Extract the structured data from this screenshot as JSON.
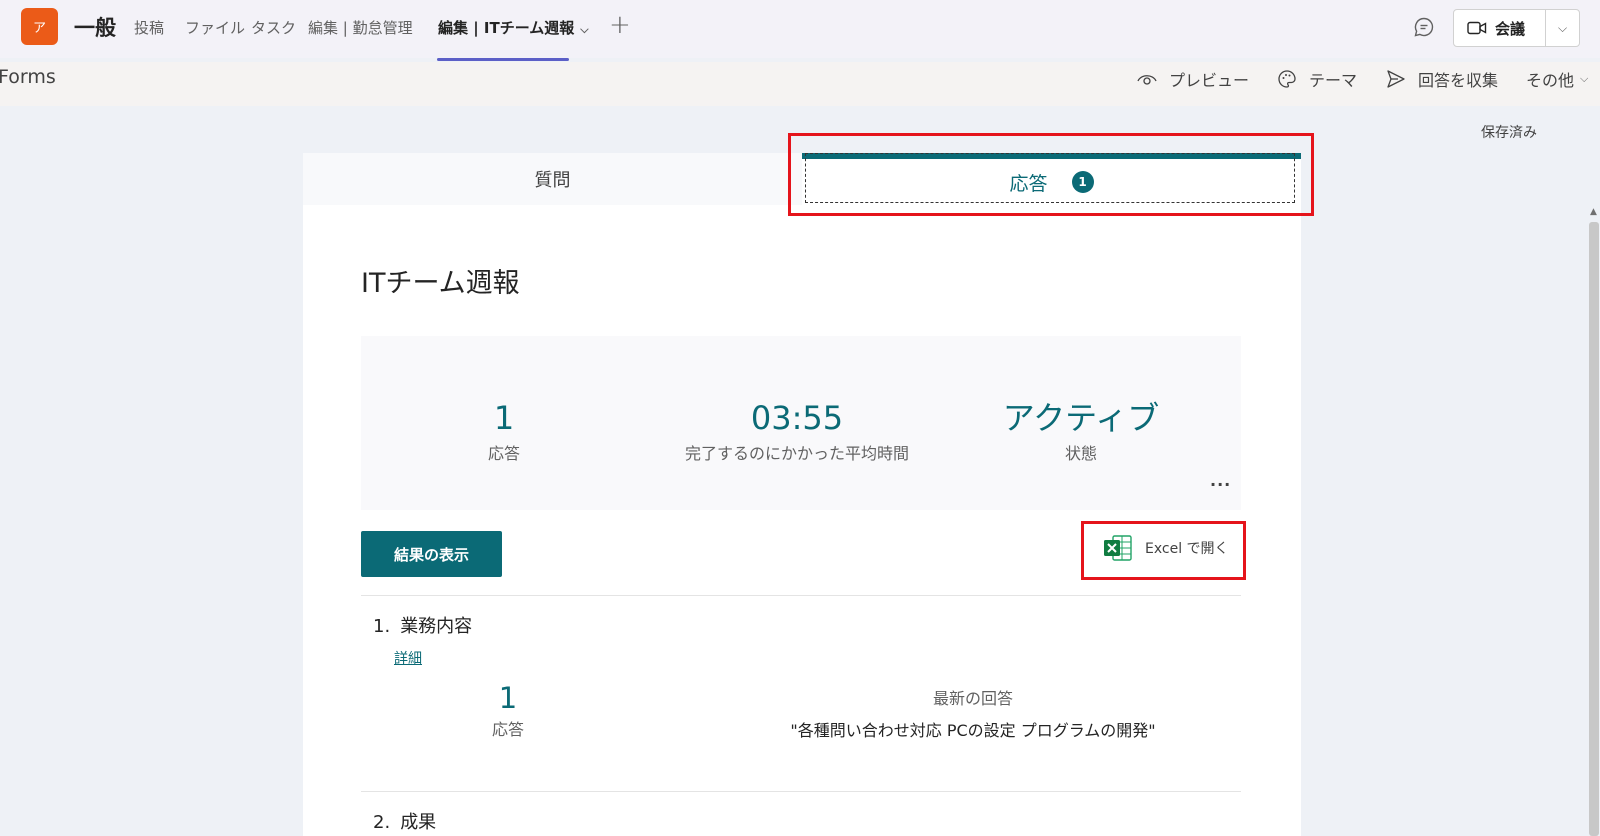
{
  "header": {
    "team_initial": "ア",
    "channel": "一般",
    "tabs": [
      "投稿",
      "ファイル",
      "タスク",
      "編集 | 勤怠管理",
      "編集 | ITチーム週報"
    ],
    "meeting_label": "会議"
  },
  "forms_bar": {
    "app_label": "Forms",
    "preview": "プレビュー",
    "theme": "テーマ",
    "collect": "回答を収集",
    "more": "その他"
  },
  "status": {
    "saved": "保存済み"
  },
  "card": {
    "tab_questions": "質問",
    "tab_responses": "応答",
    "responses_badge": "1",
    "title": "ITチーム週報",
    "stats": {
      "responses_value": "1",
      "responses_label": "応答",
      "avg_time_value": "03:55",
      "avg_time_label": "完了するのにかかった平均時間",
      "state_value": "アクティブ",
      "state_label": "状態",
      "more": "..."
    },
    "view_results": "結果の表示",
    "open_excel": "Excel で開く",
    "questions": [
      {
        "number": "1.",
        "title": "業務内容",
        "detail_link": "詳細",
        "count": "1",
        "count_label": "応答",
        "latest_label": "最新の回答",
        "latest_text": "\"各種問い合わせ対応 PCの設定 プログラムの開発\""
      },
      {
        "number": "2.",
        "title": "成果"
      }
    ]
  },
  "colors": {
    "accent": "#0b6a76",
    "teams_tab": "#5b5fc7",
    "highlight": "#e5141b",
    "team_avatar": "#eb5b18"
  }
}
